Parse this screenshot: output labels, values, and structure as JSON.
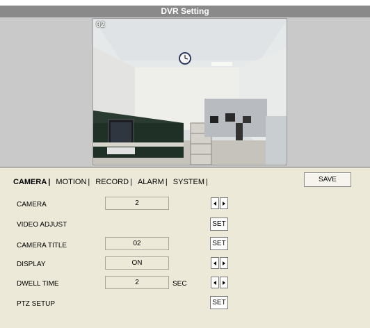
{
  "window": {
    "title": "DVR Setting"
  },
  "preview": {
    "camera_overlay": "02"
  },
  "tabs": [
    {
      "label": "CAMERA",
      "active": true
    },
    {
      "label": "MOTION"
    },
    {
      "label": "RECORD"
    },
    {
      "label": "ALARM"
    },
    {
      "label": "SYSTEM"
    }
  ],
  "toolbar": {
    "save_label": "SAVE"
  },
  "settings": {
    "camera": {
      "label": "CAMERA",
      "value": "2",
      "control": "arrows"
    },
    "video_adjust": {
      "label": "VIDEO ADJUST",
      "button": "SET"
    },
    "camera_title": {
      "label": "CAMERA TITLE",
      "value": "02",
      "button": "SET"
    },
    "display": {
      "label": "DISPLAY",
      "value": "ON",
      "control": "arrows"
    },
    "dwell_time": {
      "label": "DWELL TIME",
      "value": "2",
      "unit": "SEC",
      "control": "arrows"
    },
    "ptz_setup": {
      "label": "PTZ SETUP",
      "button": "SET"
    }
  },
  "icons": {
    "arrow_left": "triangle-left-icon",
    "arrow_right": "triangle-right-icon"
  },
  "colors": {
    "title_bar": "#8a8a8a",
    "preview_background": "#c9c9c9",
    "panel_background": "#ece9d8"
  }
}
